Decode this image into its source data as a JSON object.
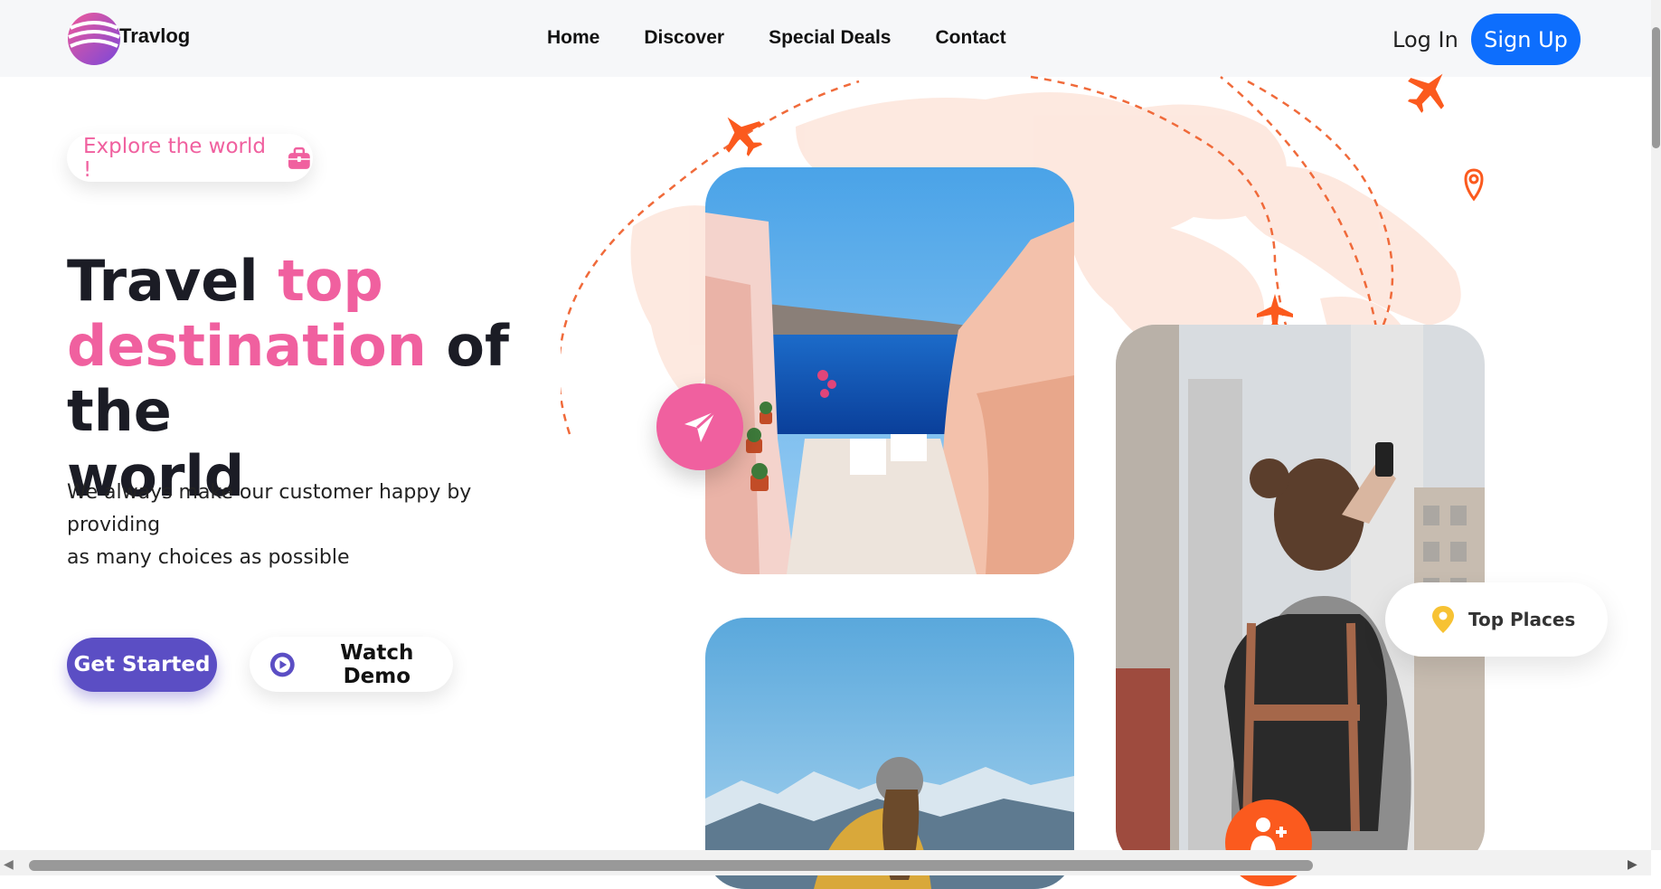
{
  "navbar": {
    "brand": "Travlog",
    "links": [
      "Home",
      "Discover",
      "Special Deals",
      "Contact"
    ],
    "login": "Log In",
    "signup": "Sign Up"
  },
  "hero": {
    "pill_text": "Explore the world !",
    "heading_part1": "Travel ",
    "heading_highlight1": "top",
    "heading_highlight2": "destination",
    "heading_part2": " of the",
    "heading_part3": "world",
    "desc_line1": "We always make our customer happy by",
    "desc_line2": "providing",
    "desc_line3": "as many choices as possible",
    "get_started": "Get Started",
    "watch_demo": "Watch Demo"
  },
  "cards": {
    "top_places": "Top Places"
  },
  "colors": {
    "pink": "#f0609f",
    "purple": "#5b4ec4",
    "blue": "#0d6efd",
    "orange": "#fb5a1e",
    "map_peach": "#fde5da"
  },
  "icons": [
    "logo-icon",
    "briefcase-icon",
    "play-icon",
    "send-icon",
    "map-pin-icon",
    "user-plus-icon",
    "airplane-icon",
    "location-icon"
  ]
}
